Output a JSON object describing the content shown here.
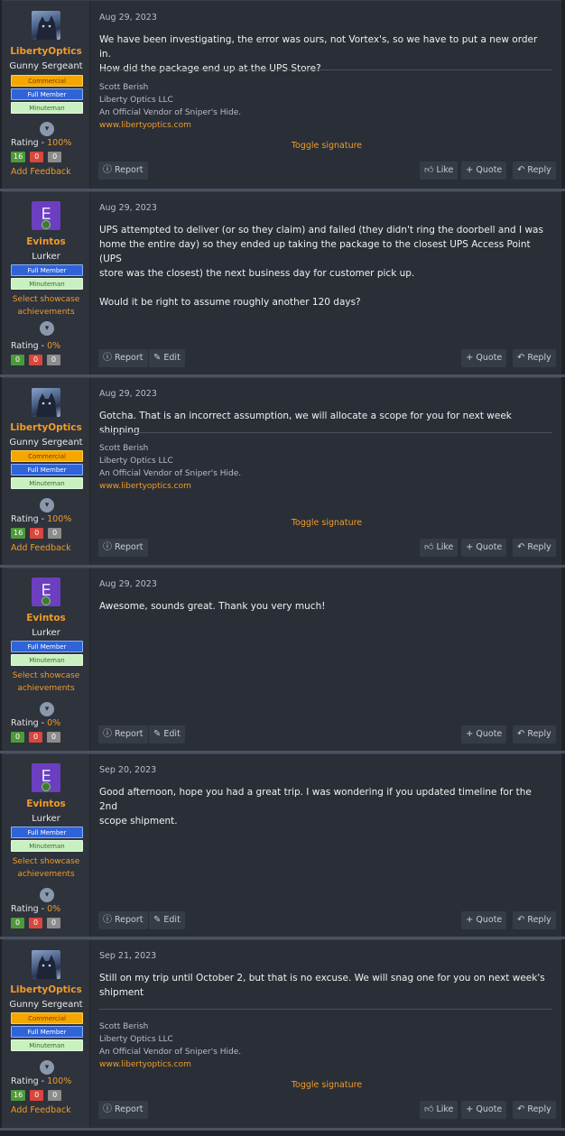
{
  "posts": [
    {
      "user": "LibertyOptics",
      "title": "Gunny Sergeant",
      "badges": [
        "Commercial Supporter",
        "Full Member",
        "Minuteman"
      ],
      "rating_label": "Rating - ",
      "rating_pct": "100%",
      "feedback": [
        "16",
        "0",
        "0"
      ],
      "add_feedback": "Add Feedback",
      "date": "Aug 29, 2023",
      "body_lines": [
        "We have been investigating, the error was ours, not Vortex's, so we have to put a new order in.",
        "How did the package end up at the UPS Store?"
      ],
      "sig": [
        "Scott Berish",
        "Liberty Optics LLC",
        "An Official Vendor of Sniper's Hide.",
        "www.libertyoptics.com"
      ],
      "toggle": "Toggle signature",
      "actions": {
        "report": "Report",
        "like": "Like",
        "quote": "Quote",
        "reply": "Reply"
      }
    },
    {
      "user": "Evintos",
      "title": "Lurker",
      "avatar_letter": "E",
      "badges": [
        "Full Member",
        "Minuteman"
      ],
      "showcase": [
        "Select showcase",
        "achievements"
      ],
      "rating_label": "Rating - ",
      "rating_pct": "0%",
      "feedback": [
        "0",
        "0",
        "0"
      ],
      "date": "Aug 29, 2023",
      "body_lines": [
        "UPS attempted to deliver (or so they claim) and failed (they didn't ring the doorbell and I was",
        "home the entire day) so they ended up taking the package to the closest UPS Access Point (UPS",
        "store was the closest) the next business day for customer pick up.",
        "",
        "Would it be right to assume roughly another 120 days?"
      ],
      "actions": {
        "report": "Report",
        "edit": "Edit",
        "quote": "Quote",
        "reply": "Reply"
      }
    },
    {
      "user": "LibertyOptics",
      "title": "Gunny Sergeant",
      "badges": [
        "Commercial Supporter",
        "Full Member",
        "Minuteman"
      ],
      "rating_label": "Rating - ",
      "rating_pct": "100%",
      "feedback": [
        "16",
        "0",
        "0"
      ],
      "add_feedback": "Add Feedback",
      "date": "Aug 29, 2023",
      "body_lines": [
        "Gotcha. That is an incorrect assumption, we will allocate a scope for you for next week shipping"
      ],
      "sig": [
        "Scott Berish",
        "Liberty Optics LLC",
        "An Official Vendor of Sniper's Hide.",
        "www.libertyoptics.com"
      ],
      "toggle": "Toggle signature",
      "actions": {
        "report": "Report",
        "like": "Like",
        "quote": "Quote",
        "reply": "Reply"
      }
    },
    {
      "user": "Evintos",
      "title": "Lurker",
      "avatar_letter": "E",
      "badges": [
        "Full Member",
        "Minuteman"
      ],
      "showcase": [
        "Select showcase",
        "achievements"
      ],
      "rating_label": "Rating - ",
      "rating_pct": "0%",
      "feedback": [
        "0",
        "0",
        "0"
      ],
      "date": "Aug 29, 2023",
      "body_lines": [
        "Awesome, sounds great. Thank you very much!"
      ],
      "actions": {
        "report": "Report",
        "edit": "Edit",
        "quote": "Quote",
        "reply": "Reply"
      }
    },
    {
      "user": "Evintos",
      "title": "Lurker",
      "avatar_letter": "E",
      "badges": [
        "Full Member",
        "Minuteman"
      ],
      "showcase": [
        "Select showcase",
        "achievements"
      ],
      "rating_label": "Rating - ",
      "rating_pct": "0%",
      "feedback": [
        "0",
        "0",
        "0"
      ],
      "date": "Sep 20, 2023",
      "body_lines": [
        "Good afternoon, hope you had a great trip. I was wondering if you updated timeline for the 2nd",
        "scope shipment."
      ],
      "actions": {
        "report": "Report",
        "edit": "Edit",
        "quote": "Quote",
        "reply": "Reply"
      }
    },
    {
      "user": "LibertyOptics",
      "title": "Gunny Sergeant",
      "badges": [
        "Commercial Supporter",
        "Full Member",
        "Minuteman"
      ],
      "rating_label": "Rating - ",
      "rating_pct": "100%",
      "feedback": [
        "16",
        "0",
        "0"
      ],
      "add_feedback": "Add Feedback",
      "date": "Sep 21, 2023",
      "body_lines": [
        "Still on my trip until October 2, but that is no excuse. We will snag one for you on next week's",
        "shipment"
      ],
      "sig": [
        "Scott Berish",
        "Liberty Optics LLC",
        "An Official Vendor of Sniper's Hide.",
        "www.libertyoptics.com"
      ],
      "toggle": "Toggle signature",
      "actions": {
        "report": "Report",
        "like": "Like",
        "quote": "Quote",
        "reply": "Reply"
      }
    }
  ],
  "colors": {
    "accent": "#f09b2b",
    "background": "#2a2f37",
    "user_column": "#2e333c"
  },
  "icons": {
    "report": "info-circle-icon",
    "like": "thumbs-up-icon",
    "quote": "plus-icon",
    "reply": "reply-arrow-icon",
    "edit": "pencil-icon",
    "expand": "chevron-down-icon"
  }
}
